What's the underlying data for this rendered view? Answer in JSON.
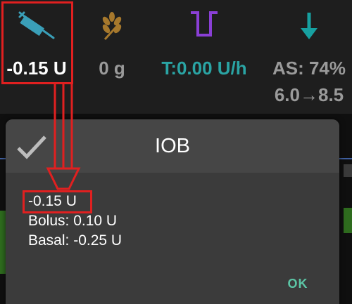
{
  "topbar": {
    "iob": {
      "value": "-0.15 U",
      "icon": "syringe-icon"
    },
    "carbs": {
      "value": "0 g",
      "icon": "wheat-icon"
    },
    "temp_basal": {
      "value": "T:0.00 U/h",
      "icon": "temp-basal-icon"
    },
    "autosens": {
      "value": "AS: 74%",
      "range": "6.0→8.5",
      "icon": "arrow-down-icon"
    }
  },
  "dialog": {
    "title": "IOB",
    "total": "-0.15 U",
    "bolus": "Bolus: 0.10 U",
    "basal": "Basal: -0.25 U",
    "ok_label": "OK"
  },
  "colors": {
    "syringe": "#3a9fb8",
    "wheat": "#a6782c",
    "temp": "#8a3fd6",
    "temp_text": "#2aa4a4",
    "arrow": "#17a0a0",
    "highlight": "#e02020",
    "ok": "#5cc6a6"
  }
}
